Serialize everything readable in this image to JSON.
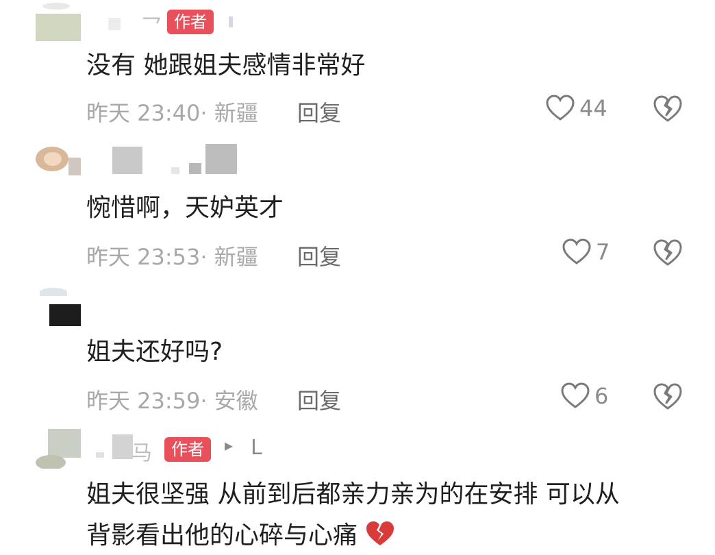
{
  "comments": [
    {
      "author_suffix": "乛",
      "badge": "作者",
      "text": "没有 她跟姐夫感情非常好",
      "time": "昨天 23:40· 新疆",
      "reply": "回复",
      "likes": "44",
      "liked": false
    },
    {
      "author_suffix": "",
      "badge": "",
      "text": "惋惜啊，天妒英才",
      "time": "昨天 23:53· 新疆",
      "reply": "回复",
      "likes": "7",
      "liked": false
    },
    {
      "author_suffix": "",
      "badge": "",
      "text": "姐夫还好吗?",
      "time": "昨天 23:59· 安徽",
      "reply": "回复",
      "likes": "6",
      "liked": false
    },
    {
      "author_suffix": "马",
      "badge": "作者",
      "reply_arrow": "▸",
      "reply_to": "L",
      "text_line1": "姐夫很坚强 从前到后都亲力亲为的在安排 可以从",
      "text_line2": "背影看出他的心碎与心痛",
      "emoji": "broken-heart-emoji"
    }
  ],
  "icons": {
    "like": "heart-outline-icon",
    "dislike": "broken-heart-outline-icon"
  },
  "colors": {
    "badge": "#e8505b",
    "meta": "#a8a8a8",
    "reply": "#6a6a6a",
    "text": "#1f1f1f",
    "emoji": "#d93a3a"
  }
}
